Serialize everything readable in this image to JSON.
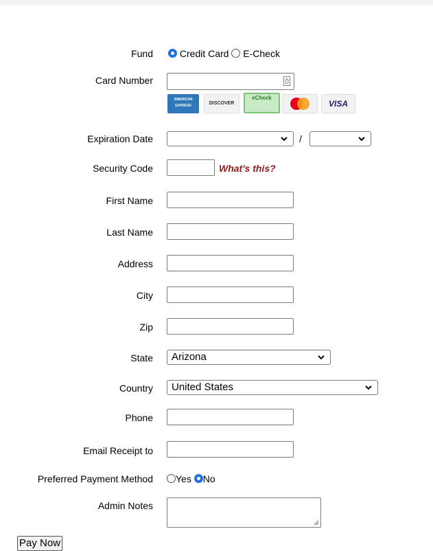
{
  "fund": {
    "label": "Fund",
    "options": [
      {
        "label": "Credit Card",
        "selected": true
      },
      {
        "label": "E-Check",
        "selected": false
      }
    ]
  },
  "card_number": {
    "label": "Card Number",
    "value": ""
  },
  "card_icons": [
    {
      "name": "american-express-icon",
      "text": "AMERICAN EXPRESS",
      "color": "#2e77bb"
    },
    {
      "name": "discover-icon",
      "text": "DISCOVER",
      "color": "#f58220"
    },
    {
      "name": "echeck-icon",
      "text": "eCheck",
      "color": "#7cc576"
    },
    {
      "name": "mastercard-icon",
      "text": "",
      "color": "#eb001b"
    },
    {
      "name": "visa-icon",
      "text": "VISA",
      "color": "#1a1f71"
    }
  ],
  "expiration": {
    "label": "Expiration Date",
    "separator": "/",
    "month": "",
    "year": ""
  },
  "security_code": {
    "label": "Security Code",
    "value": "",
    "help_link": "What's this?",
    "help_color": "#8b1a1a"
  },
  "first_name": {
    "label": "First Name",
    "value": ""
  },
  "last_name": {
    "label": "Last Name",
    "value": ""
  },
  "address": {
    "label": "Address",
    "value": ""
  },
  "city": {
    "label": "City",
    "value": ""
  },
  "zip": {
    "label": "Zip",
    "value": ""
  },
  "state": {
    "label": "State",
    "value": "Arizona"
  },
  "country": {
    "label": "Country",
    "value": "United States"
  },
  "phone": {
    "label": "Phone",
    "value": ""
  },
  "email_receipt": {
    "label": "Email Receipt to",
    "value": ""
  },
  "preferred_payment": {
    "label": "Preferred Payment Method",
    "options": [
      {
        "label": "Yes",
        "selected": false
      },
      {
        "label": "No",
        "selected": true
      }
    ]
  },
  "admin_notes": {
    "label": "Admin Notes",
    "value": ""
  },
  "submit": {
    "label": "Pay Now"
  }
}
